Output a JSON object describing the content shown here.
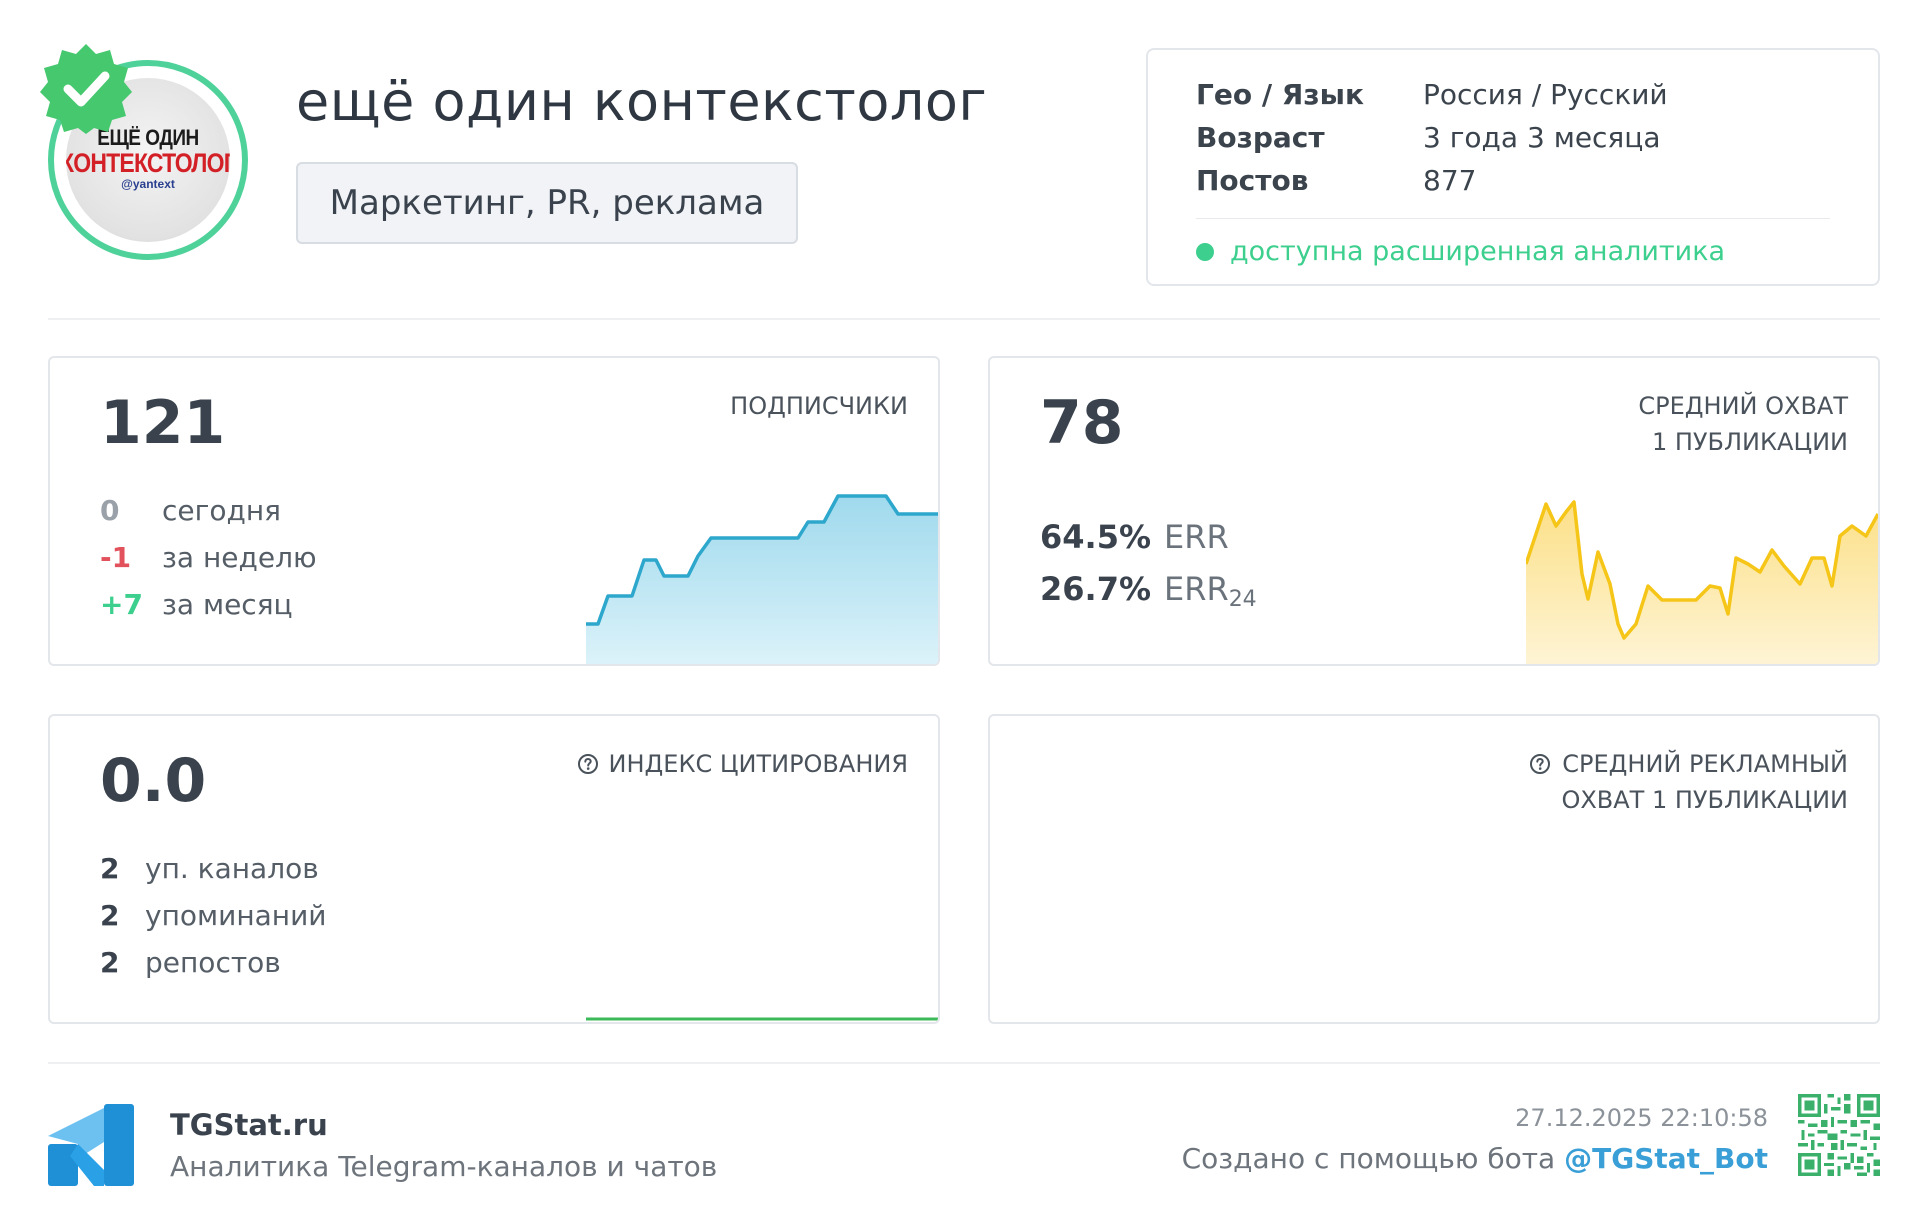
{
  "channel": {
    "title": "ещё один контекстолог",
    "category": "Маркетинг, PR, реклама",
    "avatar": {
      "line1": "ЕЩЁ ОДИН",
      "line2": "КОНТЕКСТОЛОГ",
      "line3": "@yantext",
      "ring_color": "#4fd19a"
    },
    "verified_icon": "verified-badge-icon"
  },
  "info": {
    "rows": [
      {
        "key": "Гео / Язык",
        "value": "Россия / Русский"
      },
      {
        "key": "Возраст",
        "value": "3 года 3 месяца"
      },
      {
        "key": "Постов",
        "value": "877"
      }
    ],
    "analytics_note": "доступна расширенная аналитика",
    "accent_color": "#3ccf8e"
  },
  "subscribers": {
    "value": "121",
    "label": "ПОДПИСЧИКИ",
    "rows": [
      {
        "num": "0",
        "text": "сегодня",
        "tone": "gray"
      },
      {
        "num": "-1",
        "text": "за неделю",
        "tone": "red"
      },
      {
        "num": "+7",
        "text": "за месяц",
        "tone": "green"
      }
    ],
    "chart_color": "#2ea7cc"
  },
  "reach": {
    "value": "78",
    "label_line1": "СРЕДНИЙ ОХВАТ",
    "label_line2": "1 ПУБЛИКАЦИИ",
    "err": {
      "value": "64.5%",
      "name": "ERR"
    },
    "err24": {
      "value": "26.7%",
      "name": "ERR",
      "sub": "24"
    },
    "chart_color": "#f5c518"
  },
  "citation": {
    "value": "0.0",
    "label": "ИНДЕКС ЦИТИРОВАНИЯ",
    "rows": [
      {
        "num": "2",
        "text": "уп. каналов"
      },
      {
        "num": "2",
        "text": "упоминаний"
      },
      {
        "num": "2",
        "text": "репостов"
      }
    ],
    "chart_color": "#3cba5a"
  },
  "ad_reach": {
    "label_line1": "СРЕДНИЙ РЕКЛАМНЫЙ",
    "label_line2": "ОХВАТ 1 ПУБЛИКАЦИИ"
  },
  "footer": {
    "brand": "TGStat.ru",
    "tagline": "Аналитика Telegram-каналов и чатов",
    "datetime": "27.12.2025 22:10:58",
    "made_with": "Создано с помощью бота",
    "bot": "@TGStat_Bot"
  }
}
